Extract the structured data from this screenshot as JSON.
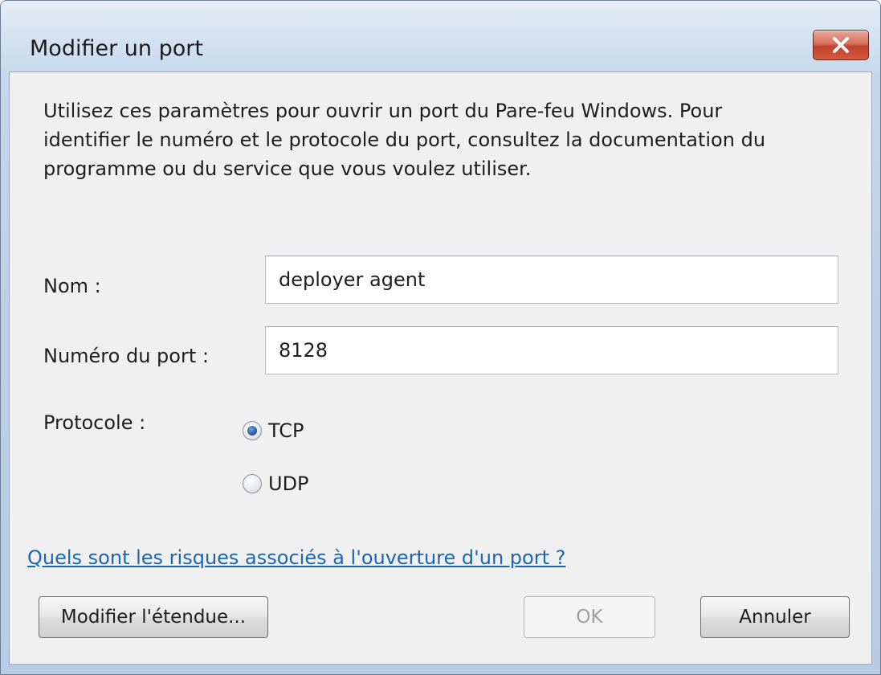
{
  "window": {
    "title": "Modifier un port"
  },
  "description": "Utilisez ces paramètres pour ouvrir un port du Pare-feu Windows. Pour\nidentifier le numéro et le protocole du port, consultez la documentation du\nprogramme ou du service que vous voulez utiliser.",
  "form": {
    "name_label": "Nom :",
    "name_value": "deployer agent",
    "port_label": "Numéro du port :",
    "port_value": "8128",
    "protocol_label": "Protocole :",
    "protocols": [
      {
        "label": "TCP",
        "selected": true
      },
      {
        "label": "UDP",
        "selected": false
      }
    ]
  },
  "help_link": "Quels sont les risques associés à l'ouverture d'un port ?",
  "buttons": {
    "scope": "Modifier l'étendue...",
    "ok": "OK",
    "ok_enabled": false,
    "cancel": "Annuler"
  },
  "icons": {
    "close": "close-icon",
    "radio_checked": "radio-checked-icon",
    "radio_unchecked": "radio-unchecked-icon"
  },
  "colors": {
    "link": "#1a66b5",
    "close_button": "#c2412b",
    "titlebar": "#d6e3f2"
  }
}
